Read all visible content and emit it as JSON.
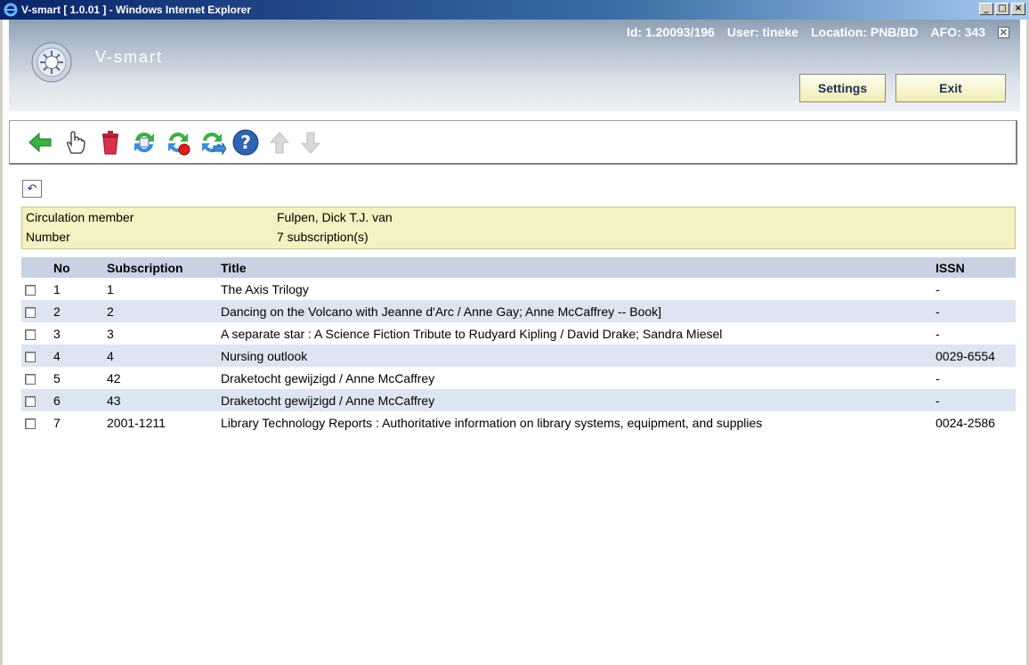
{
  "window": {
    "title": "V-smart [ 1.0.01 ] - Windows Internet Explorer",
    "buttons": [
      "_",
      "□",
      "×"
    ]
  },
  "header": {
    "brand": "V-smart",
    "id_text": "Id: 1.20093/196",
    "user_text": "User: tineke",
    "location_text": "Location: PNB/BD",
    "afo_text": "AFO: 343",
    "settings_label": "Settings",
    "exit_label": "Exit"
  },
  "toolbar": {
    "icons": [
      "back-arrow-icon",
      "select-hand-icon",
      "delete-bin-icon",
      "refresh-in-icon",
      "refresh-stop-icon",
      "refresh-out-icon",
      "help-icon",
      "arrow-up-icon",
      "arrow-down-icon"
    ]
  },
  "panel": {
    "member_label": "Circulation member",
    "member_value": "Fulpen, Dick T.J. van",
    "number_label": "Number",
    "number_value": "7 subscription(s)"
  },
  "table": {
    "headers": [
      "No",
      "Subscription",
      "Title",
      "ISSN"
    ],
    "rows": [
      {
        "no": "1",
        "subscription": "1",
        "title": "The Axis Trilogy",
        "issn": "-"
      },
      {
        "no": "2",
        "subscription": "2",
        "title": "Dancing on the Volcano with Jeanne d'Arc / Anne Gay; Anne McCaffrey -- Book]",
        "issn": "-"
      },
      {
        "no": "3",
        "subscription": "3",
        "title": "A separate star : A Science Fiction Tribute to Rudyard Kipling / David Drake; Sandra Miesel",
        "issn": "-"
      },
      {
        "no": "4",
        "subscription": "4",
        "title": "Nursing outlook",
        "issn": "0029-6554"
      },
      {
        "no": "5",
        "subscription": "42",
        "title": "Draketocht gewijzigd / Anne McCaffrey",
        "issn": "-"
      },
      {
        "no": "6",
        "subscription": "43",
        "title": "Draketocht gewijzigd / Anne McCaffrey",
        "issn": "-"
      },
      {
        "no": "7",
        "subscription": "2001-1211",
        "title": "Library Technology Reports : Authoritative information on library systems, equipment, and supplies",
        "issn": "0024-2586"
      }
    ]
  },
  "colors": {
    "panel_bg": "#f4f2c2",
    "table_header_bg": "#c7d2e5",
    "row_alt_bg": "#dde5f2",
    "button_bg": "#f1edb4",
    "button_text": "#1f2e55"
  }
}
